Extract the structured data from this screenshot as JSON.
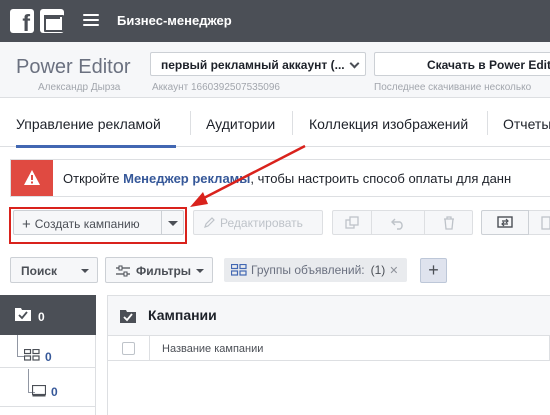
{
  "topbar": {
    "title": "Бизнес-менеджер"
  },
  "header": {
    "app_title": "Power Editor",
    "user_name": "Александр Дырза",
    "account_select": "первый рекламный аккаунт (...",
    "account_id": "Аккаунт 1660392507535096",
    "download_label": "Скачать в Power Edit",
    "last_download": "Последнее скачивание несколько"
  },
  "tabs": [
    {
      "label": "Управление рекламой"
    },
    {
      "label": "Аудитории"
    },
    {
      "label": "Коллекция изображений"
    },
    {
      "label": "Отчеты"
    }
  ],
  "alert": {
    "prefix": "Откройте ",
    "link": "Менеджер рекламы",
    "suffix": ", чтобы настроить способ оплаты для данн"
  },
  "toolbar": {
    "create_label": "Создать кампанию",
    "edit_label": "Редактировать"
  },
  "filters": {
    "search_label": "Поиск",
    "filters_label": "Фильтры",
    "groups_label": "Группы объявлений:",
    "groups_count": "(1)"
  },
  "tree": {
    "campaigns_count": "0",
    "adsets_count": "0",
    "ads_count": "0"
  },
  "campaigns": {
    "title": "Кампании",
    "column_name": "Название кампании"
  },
  "colors": {
    "topbar": "#4b4f56",
    "accent_blue": "#4267b2",
    "link_blue": "#365899",
    "alert_red": "#e04a41",
    "annotation_red": "#d9221c"
  }
}
